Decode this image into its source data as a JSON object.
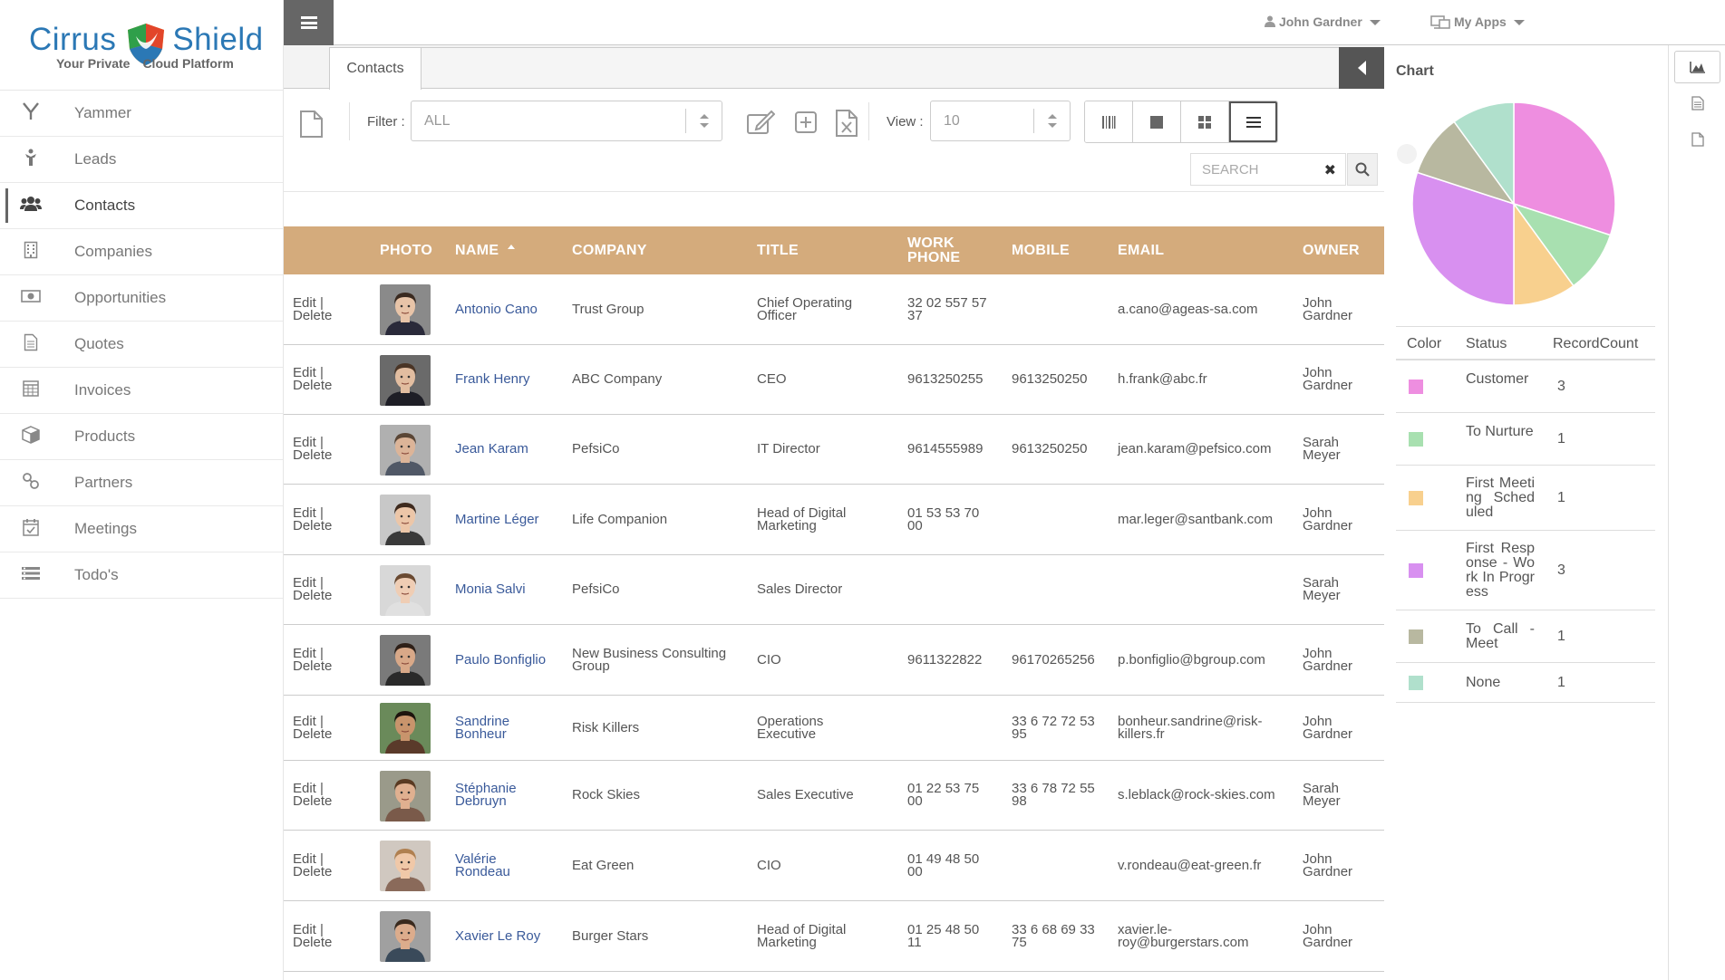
{
  "brand": {
    "word1": "Cirrus",
    "word2": "Shield",
    "tagline1": "Your Private",
    "tagline2": "Cloud Platform"
  },
  "sidebar": {
    "items": [
      {
        "label": "Yammer",
        "icon": "yammer-icon"
      },
      {
        "label": "Leads",
        "icon": "leads-icon"
      },
      {
        "label": "Contacts",
        "icon": "contacts-icon",
        "active": true
      },
      {
        "label": "Companies",
        "icon": "companies-icon"
      },
      {
        "label": "Opportunities",
        "icon": "opportunities-icon"
      },
      {
        "label": "Quotes",
        "icon": "quotes-icon"
      },
      {
        "label": "Invoices",
        "icon": "invoices-icon"
      },
      {
        "label": "Products",
        "icon": "products-icon"
      },
      {
        "label": "Partners",
        "icon": "partners-icon"
      },
      {
        "label": "Meetings",
        "icon": "meetings-icon"
      },
      {
        "label": "Todo's",
        "icon": "todo-icon"
      }
    ]
  },
  "topbar": {
    "user": "John Gardner",
    "apps": "My Apps"
  },
  "tabs": {
    "active": "Contacts"
  },
  "toolbar": {
    "filter_label": "Filter :",
    "filter_value": "ALL",
    "view_label": "View :",
    "view_value": "10",
    "search_placeholder": "SEARCH"
  },
  "table": {
    "headers": {
      "photo": "PHOTO",
      "name": "NAME",
      "company": "COMPANY",
      "title": "TITLE",
      "work1": "WORK",
      "work2": "PHONE",
      "mobile": "MOBILE",
      "email": "EMAIL",
      "owner": "OWNER"
    },
    "edit": "Edit",
    "delete": "Delete",
    "rows": [
      {
        "name": [
          "Antonio Cano"
        ],
        "company": [
          "Trust Group"
        ],
        "title": [
          "Chief Operating",
          "Officer"
        ],
        "work": [
          "32 02 557 57",
          "37"
        ],
        "mobile": [],
        "email": [
          "a.cano@ageas-sa.com"
        ],
        "owner": [
          "John",
          "Gardner"
        ],
        "skin": "#e8c4a8",
        "hair": "#3a2a20",
        "bg": "#8a8a8a",
        "shirt": "#2a2a3a"
      },
      {
        "name": [
          "Frank Henry"
        ],
        "company": [
          "ABC Company"
        ],
        "title": [
          "CEO"
        ],
        "work": [
          "9613250255"
        ],
        "mobile": [
          "9613250250"
        ],
        "email": [
          "h.frank@abc.fr"
        ],
        "owner": [
          "John",
          "Gardner"
        ],
        "skin": "#e2bda0",
        "hair": "#4a3526",
        "bg": "#6a6a6a",
        "shirt": "#1e1e26"
      },
      {
        "name": [
          "Jean Karam"
        ],
        "company": [
          "PefsiCo"
        ],
        "title": [
          "IT Director"
        ],
        "work": [
          "9614555989"
        ],
        "mobile": [
          "9613250250"
        ],
        "email": [
          "jean.karam@pefsico.com"
        ],
        "owner": [
          "Sarah",
          "Meyer"
        ],
        "skin": "#dcb498",
        "hair": "#5a4636",
        "bg": "#b0b0b0",
        "shirt": "#505866"
      },
      {
        "name": [
          "Martine Léger"
        ],
        "company": [
          "Life Companion"
        ],
        "title": [
          "Head of Digital",
          "Marketing"
        ],
        "work": [
          "01 53 53 70",
          "00"
        ],
        "mobile": [],
        "email": [
          "mar.leger@santbank.com"
        ],
        "owner": [
          "John",
          "Gardner"
        ],
        "skin": "#ecc6a8",
        "hair": "#3e2a1e",
        "bg": "#c8c8c8",
        "shirt": "#3a3a3a"
      },
      {
        "name": [
          "Monia Salvi"
        ],
        "company": [
          "PefsiCo"
        ],
        "title": [
          "Sales Director"
        ],
        "work": [],
        "mobile": [],
        "email": [],
        "owner": [
          "Sarah",
          "Meyer"
        ],
        "skin": "#efcdb4",
        "hair": "#6a4a32",
        "bg": "#d8d8d8",
        "shirt": "#e0e0e0"
      },
      {
        "name": [
          "Paulo Bonfiglio"
        ],
        "company": [
          "New Business Consulting",
          "Group"
        ],
        "title": [
          "CIO"
        ],
        "work": [
          "9611322822"
        ],
        "mobile": [
          "96170265256"
        ],
        "email": [
          "p.bonfiglio@bgroup.com"
        ],
        "owner": [
          "John",
          "Gardner"
        ],
        "skin": "#d8a888",
        "hair": "#2e2018",
        "bg": "#7a7a7a",
        "shirt": "#2a2a2a"
      },
      {
        "name": [
          "Sandrine",
          "Bonheur"
        ],
        "company": [
          "Risk Killers"
        ],
        "title": [
          "Operations",
          "Executive"
        ],
        "work": [],
        "mobile": [
          "33 6 72 72 53",
          "95"
        ],
        "email": [
          "bonheur.sandrine@risk-",
          "killers.fr"
        ],
        "owner": [
          "John",
          "Gardner"
        ],
        "skin": "#c8946c",
        "hair": "#1e140e",
        "bg": "#6a8a5a",
        "shirt": "#5a3a2a"
      },
      {
        "name": [
          "Stéphanie",
          "Debruyn"
        ],
        "company": [
          "Rock Skies"
        ],
        "title": [
          "Sales Executive"
        ],
        "work": [
          "01 22 53 75",
          "00"
        ],
        "mobile": [
          "33 6 78 72 55",
          "98"
        ],
        "email": [
          "s.leblack@rock-skies.com"
        ],
        "owner": [
          "Sarah",
          "Meyer"
        ],
        "skin": "#e0b090",
        "hair": "#5a3a22",
        "bg": "#9a9a8a",
        "shirt": "#7a5a4a"
      },
      {
        "name": [
          "Valérie",
          "Rondeau"
        ],
        "company": [
          "Eat Green"
        ],
        "title": [
          "CIO"
        ],
        "work": [
          "01 49 48 50",
          "00"
        ],
        "mobile": [],
        "email": [
          "v.rondeau@eat-green.fr"
        ],
        "owner": [
          "John",
          "Gardner"
        ],
        "skin": "#f0c8a8",
        "hair": "#b08050",
        "bg": "#d0c8c0",
        "shirt": "#8a6a5a"
      },
      {
        "name": [
          "Xavier Le Roy"
        ],
        "company": [
          "Burger Stars"
        ],
        "title": [
          "Head of Digital",
          "Marketing"
        ],
        "work": [
          "01 25 48 50",
          "11"
        ],
        "mobile": [
          "33 6 68 69 33",
          "75"
        ],
        "email": [
          "xavier.le-",
          "roy@burgerstars.com"
        ],
        "owner": [
          "John",
          "Gardner"
        ],
        "skin": "#dcac8c",
        "hair": "#3a2a1e",
        "bg": "#a0a0a0",
        "shirt": "#3a4a5a"
      }
    ]
  },
  "chart": {
    "title": "Chart",
    "headers": {
      "color": "Color",
      "status": "Status",
      "count": "RecordCount"
    }
  },
  "chart_data": {
    "type": "pie",
    "title": "Chart",
    "categories": [
      "Customer",
      "To Nurture",
      "First Meeting Scheduled",
      "First Response - Work In Progress",
      "To Call - Meet",
      "None"
    ],
    "values": [
      3,
      1,
      1,
      3,
      1,
      1
    ],
    "colors": [
      "#ee8ee0",
      "#a8e0b0",
      "#f8d08e",
      "#d890f0",
      "#b8b8a0",
      "#b0e0cc"
    ],
    "legend_position": "below"
  },
  "legend_rows": [
    {
      "status": "Customer",
      "count": "3"
    },
    {
      "status": "To Nurture",
      "count": "1"
    },
    {
      "status": "First Meeting Scheduled",
      "count": "1"
    },
    {
      "status": "First Response - Work In Progress",
      "count": "3"
    },
    {
      "status": "To Call - Meet",
      "count": "1"
    },
    {
      "status": "None",
      "count": "1"
    }
  ]
}
